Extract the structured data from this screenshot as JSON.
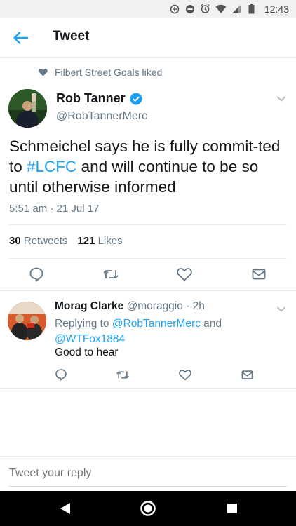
{
  "status_bar": {
    "time": "12:43",
    "icons": [
      "data-saver-icon",
      "do-not-disturb-icon",
      "alarm-icon",
      "wifi-icon",
      "signal-icon",
      "battery-icon"
    ]
  },
  "app_bar": {
    "title": "Tweet",
    "back_icon": "arrow-left-icon"
  },
  "social_context": {
    "icon": "heart-icon",
    "text": "Filbert Street Goals liked"
  },
  "tweet": {
    "author_name": "Rob Tanner",
    "verified_icon": "verified-badge-icon",
    "author_handle": "@RobTannerMerc",
    "text_before": "Schmeichel says he is fully commit-ted to ",
    "hashtag": "#LCFC",
    "text_after": " and will continue to be so until otherwise informed",
    "timestamp": "5:51 am · 21 Jul 17",
    "retweets_count": "30",
    "retweets_label": "Retweets",
    "likes_count": "121",
    "likes_label": "Likes"
  },
  "reply": {
    "author_name": "Morag Clarke",
    "author_handle": "@moraggio",
    "time_ago": "· 2h",
    "replying_prefix": "Replying to ",
    "replying_user1": "@RobTannerMerc",
    "replying_and": " and",
    "replying_user2": "@WTFox1884",
    "text": "Good to hear"
  },
  "compose": {
    "placeholder": "Tweet your reply"
  },
  "colors": {
    "accent": "#1da1f2",
    "secondary_text": "#657786",
    "primary_text": "#14171a"
  }
}
